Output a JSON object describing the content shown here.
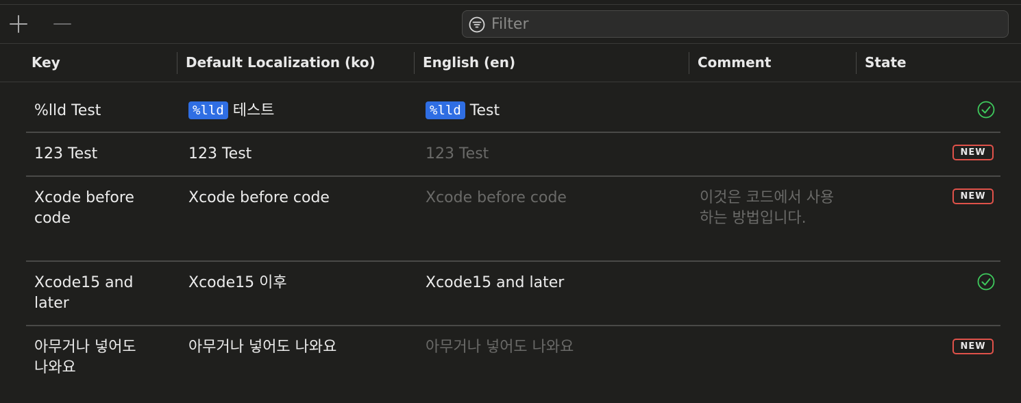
{
  "toolbar": {
    "filter_placeholder": "Filter",
    "add_icon": "plus-icon",
    "remove_icon": "minus-icon",
    "filter_icon": "filter-icon"
  },
  "columns": {
    "key": "Key",
    "default": "Default Localization (ko)",
    "english": "English (en)",
    "comment": "Comment",
    "state": "State"
  },
  "rows": [
    {
      "key": "%lld Test",
      "default_token": "%lld",
      "default_text": "테스트",
      "en_token": "%lld",
      "en_text": "Test",
      "comment": "",
      "state": "translated",
      "state_icon": "checkmark-circle-icon"
    },
    {
      "key": "123 Test",
      "default_text": "123 Test",
      "en_text": "123 Test",
      "comment": "",
      "state": "NEW"
    },
    {
      "key": "Xcode before code",
      "default_text": "Xcode before code",
      "en_text": "Xcode before code",
      "comment": "이것은 코드에서 사용하는 방법입니다.",
      "state": "NEW"
    },
    {
      "key": "Xcode15 and later",
      "default_text": "Xcode15 이후",
      "en_text": "Xcode15 and later",
      "comment": "",
      "state": "translated",
      "state_icon": "checkmark-circle-icon"
    },
    {
      "key": "아무거나 넣어도 나와요",
      "default_text": "아무거나 넣어도 나와요",
      "en_text": "아무거나 넣어도 나와요",
      "comment": "",
      "state": "NEW"
    }
  ],
  "colors": {
    "background": "#1f1f1d",
    "token_blue": "#2f6ee3",
    "check_green": "#3ec95c",
    "new_red": "#e0524a",
    "dim_text": "#6a6a68"
  }
}
